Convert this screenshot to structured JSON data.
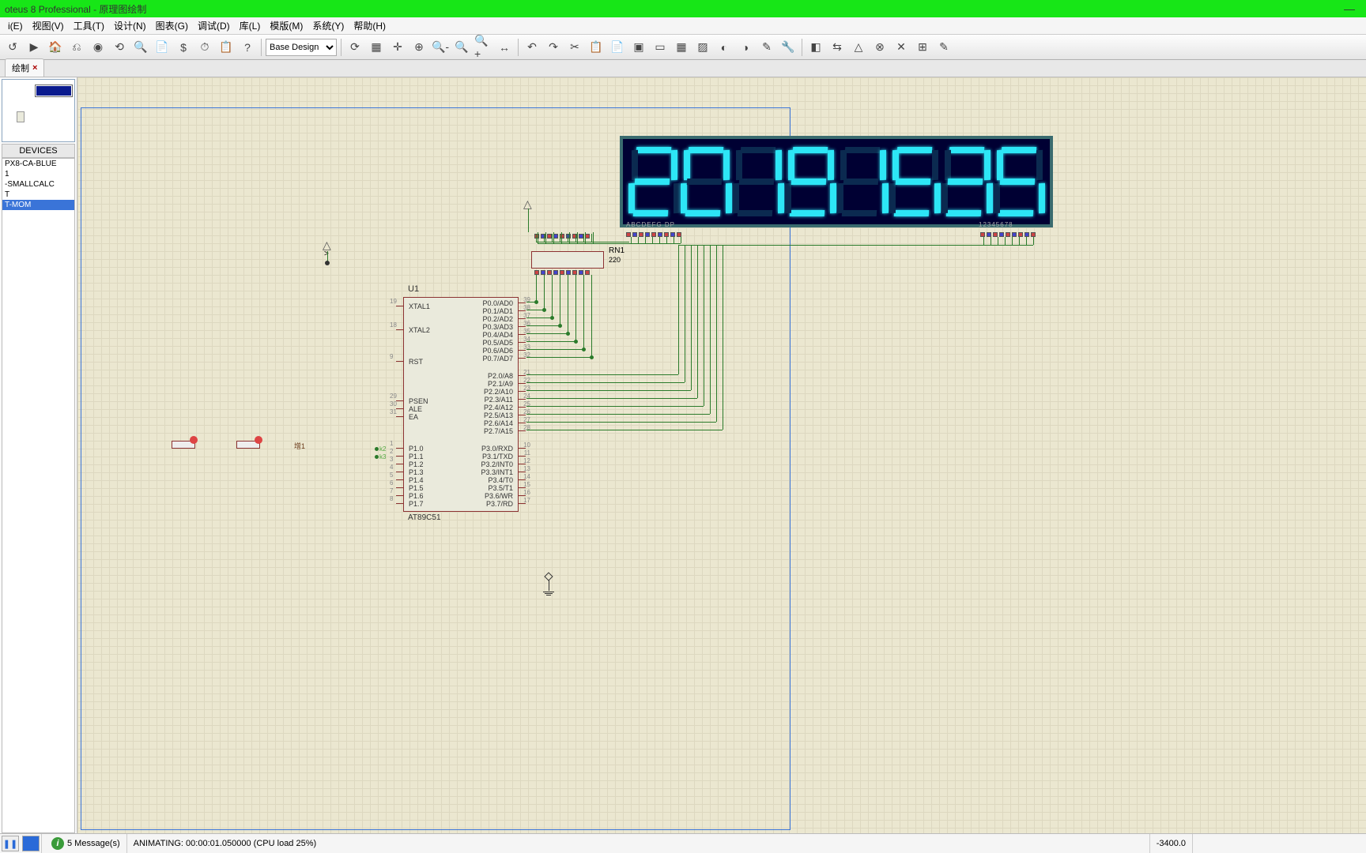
{
  "window": {
    "title": "oteus 8 Professional - 原理图绘制",
    "minimize": "—",
    "maximize": "",
    "close": ""
  },
  "menus": [
    "i(E)",
    "视图(V)",
    "工具(T)",
    "设计(N)",
    "图表(G)",
    "调试(D)",
    "库(L)",
    "模版(M)",
    "系统(Y)",
    "帮助(H)"
  ],
  "toolbar": {
    "design_selector": "Base Design",
    "icons": [
      "↺",
      "▶",
      "🏠",
      "⎌",
      "◉",
      "⟲",
      "🔍",
      "📄",
      "$",
      "⏱",
      "📋",
      "?"
    ],
    "icons2": [
      "⟳",
      "▦",
      "✛",
      "⊕",
      "🔍-",
      "🔍",
      "🔍+",
      "↔"
    ],
    "icons3": [
      "↶",
      "↷",
      "✂",
      "📋",
      "📄",
      "▣",
      "▭",
      "▦",
      "▨",
      "◐",
      "◑",
      "✎",
      "🔧"
    ],
    "icons4": [
      "◧",
      "⇆",
      "△",
      "⊗",
      "✕",
      "⊞",
      "✎"
    ]
  },
  "tab": {
    "name": "绘制",
    "close": "×"
  },
  "devices": {
    "header": "DEVICES",
    "list": [
      "PX8-CA-BLUE",
      "1",
      "-SMALLCALC",
      "T",
      "T-MOM"
    ]
  },
  "chip": {
    "ref": "U1",
    "part": "AT89C51",
    "left_pins": [
      {
        "n": "19",
        "name": "XTAL1"
      },
      {
        "n": "18",
        "name": "XTAL2"
      },
      {
        "n": "9",
        "name": "RST"
      },
      {
        "n": "29",
        "name": "PSEN"
      },
      {
        "n": "30",
        "name": "ALE"
      },
      {
        "n": "31",
        "name": "EA"
      },
      {
        "n": "1",
        "name": "P1.0"
      },
      {
        "n": "2",
        "name": "P1.1"
      },
      {
        "n": "3",
        "name": "P1.2"
      },
      {
        "n": "4",
        "name": "P1.3"
      },
      {
        "n": "5",
        "name": "P1.4"
      },
      {
        "n": "6",
        "name": "P1.5"
      },
      {
        "n": "7",
        "name": "P1.6"
      },
      {
        "n": "8",
        "name": "P1.7"
      }
    ],
    "right_pins": [
      {
        "n": "39",
        "name": "P0.0/AD0"
      },
      {
        "n": "38",
        "name": "P0.1/AD1"
      },
      {
        "n": "37",
        "name": "P0.2/AD2"
      },
      {
        "n": "36",
        "name": "P0.3/AD3"
      },
      {
        "n": "35",
        "name": "P0.4/AD4"
      },
      {
        "n": "34",
        "name": "P0.5/AD5"
      },
      {
        "n": "33",
        "name": "P0.6/AD6"
      },
      {
        "n": "32",
        "name": "P0.7/AD7"
      },
      {
        "n": "21",
        "name": "P2.0/A8"
      },
      {
        "n": "22",
        "name": "P2.1/A9"
      },
      {
        "n": "23",
        "name": "P2.2/A10"
      },
      {
        "n": "24",
        "name": "P2.3/A11"
      },
      {
        "n": "25",
        "name": "P2.4/A12"
      },
      {
        "n": "26",
        "name": "P2.5/A13"
      },
      {
        "n": "27",
        "name": "P2.6/A14"
      },
      {
        "n": "28",
        "name": "P2.7/A15"
      },
      {
        "n": "10",
        "name": "P3.0/RXD"
      },
      {
        "n": "11",
        "name": "P3.1/TXD"
      },
      {
        "n": "12",
        "name": "P3.2/INT0"
      },
      {
        "n": "13",
        "name": "P3.3/INT1"
      },
      {
        "n": "14",
        "name": "P3.4/T0"
      },
      {
        "n": "15",
        "name": "P3.5/T1"
      },
      {
        "n": "16",
        "name": "P3.6/WR"
      },
      {
        "n": "17",
        "name": "P3.7/RD"
      }
    ],
    "p1_nets": [
      "k2",
      "k3"
    ]
  },
  "rn": {
    "ref": "RN1",
    "value": "220"
  },
  "display": {
    "pins_left": "ABCDEFG DP",
    "pins_right": "12345678",
    "digits": [
      "2",
      "0",
      "1",
      "9",
      "1",
      "5",
      "3",
      "5"
    ]
  },
  "btn_label": "增1",
  "status": {
    "messages": "5 Message(s)",
    "sim": "ANIMATING: 00:00:01.050000 (CPU load 25%)",
    "coord": "-3400.0"
  },
  "segmap": {
    "0": [
      "a",
      "b",
      "c",
      "d",
      "e",
      "f"
    ],
    "1": [
      "b",
      "c"
    ],
    "2": [
      "a",
      "b",
      "g",
      "e",
      "d"
    ],
    "3": [
      "a",
      "b",
      "g",
      "c",
      "d"
    ],
    "5": [
      "a",
      "f",
      "g",
      "c",
      "d"
    ],
    "9": [
      "a",
      "b",
      "c",
      "d",
      "f",
      "g"
    ]
  }
}
